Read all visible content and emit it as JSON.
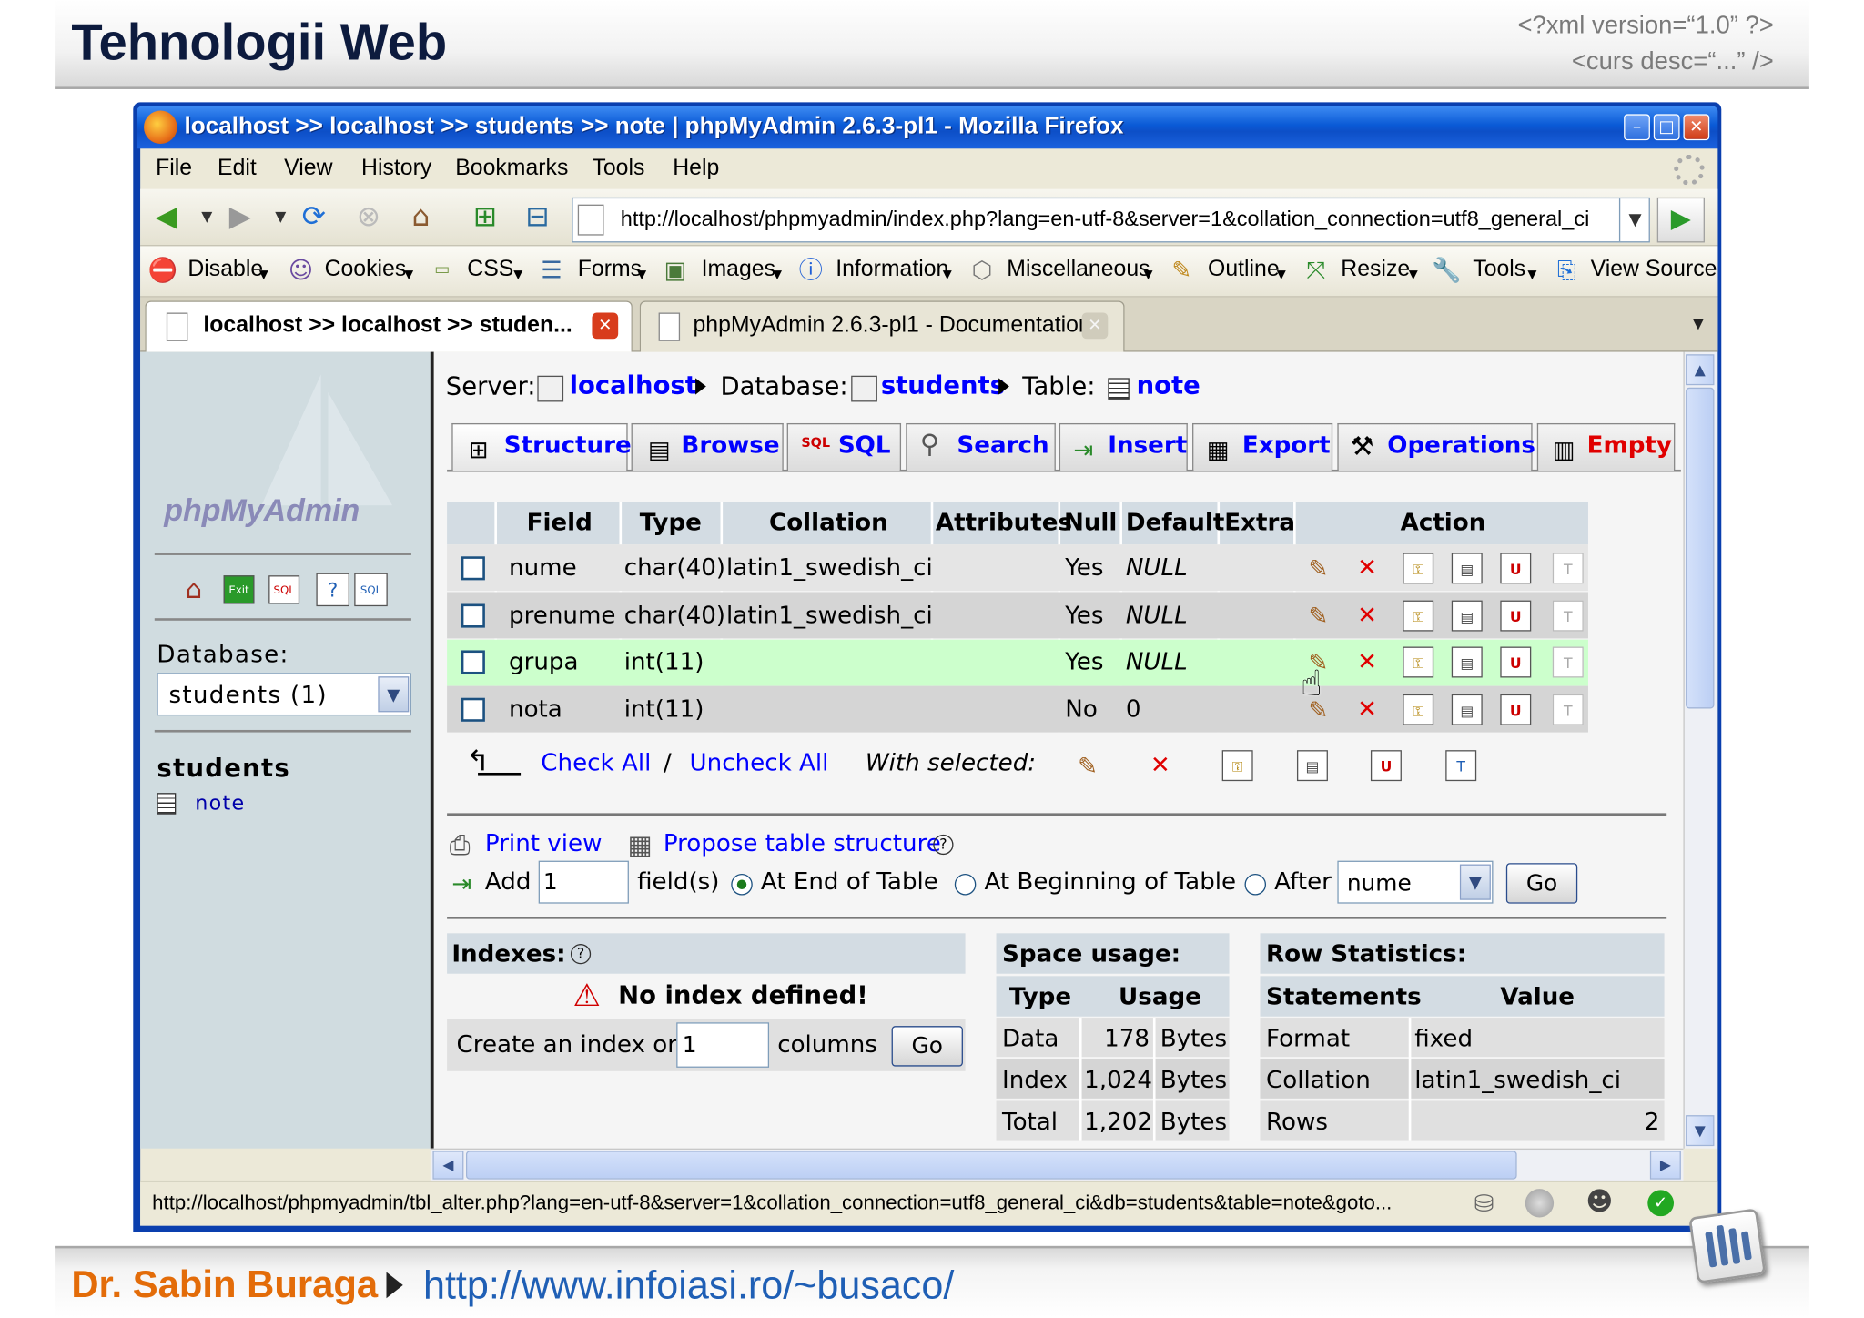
{
  "slide": {
    "title": "Tehnologii Web",
    "xml_line1": "<?xml version=“1.0” ?>",
    "xml_line2": "<curs desc=“...” />",
    "author": "Dr. Sabin Buraga",
    "url": "http://www.infoiasi.ro/~busaco/"
  },
  "browser": {
    "window_title": "localhost >> localhost >> students  >> note | phpMyAdmin 2.6.3-pl1 - Mozilla Firefox",
    "menu": [
      "File",
      "Edit",
      "View",
      "History",
      "Bookmarks",
      "Tools",
      "Help"
    ],
    "address": "http://localhost/phpmyadmin/index.php?lang=en-utf-8&server=1&collation_connection=utf8_general_ci",
    "webdev_toolbar": [
      "Disable",
      "Cookies",
      "CSS",
      "Forms",
      "Images",
      "Information",
      "Miscellaneous",
      "Outline",
      "Resize",
      "Tools",
      "View Source"
    ],
    "tabs": [
      {
        "label": "localhost >> localhost >> studen...",
        "active": true
      },
      {
        "label": "phpMyAdmin 2.6.3-pl1 - Documentation",
        "active": false
      }
    ],
    "status_url": "http://localhost/phpmyadmin/tbl_alter.php?lang=en-utf-8&server=1&collation_connection=utf8_general_ci&db=students&table=note&goto..."
  },
  "sidebar": {
    "logo": "phpMyAdmin",
    "database_label": "Database:",
    "database_select": "students (1)",
    "db_name": "students",
    "tables": [
      "note"
    ]
  },
  "breadcrumb": {
    "server_label": "Server:",
    "server": "localhost",
    "database_label": "Database:",
    "database": "students",
    "table_label": "Table:",
    "table": "note"
  },
  "main_tabs": [
    "Structure",
    "Browse",
    "SQL",
    "Search",
    "Insert",
    "Export",
    "Operations",
    "Empty"
  ],
  "structure": {
    "columns": [
      "Field",
      "Type",
      "Collation",
      "Attributes",
      "Null",
      "Default",
      "Extra",
      "Action"
    ],
    "rows": [
      {
        "field": "nume",
        "type": "char(40)",
        "collation": "latin1_swedish_ci",
        "attributes": "",
        "null": "Yes",
        "default": "NULL",
        "extra": ""
      },
      {
        "field": "prenume",
        "type": "char(40)",
        "collation": "latin1_swedish_ci",
        "attributes": "",
        "null": "Yes",
        "default": "NULL",
        "extra": ""
      },
      {
        "field": "grupa",
        "type": "int(11)",
        "collation": "",
        "attributes": "",
        "null": "Yes",
        "default": "NULL",
        "extra": ""
      },
      {
        "field": "nota",
        "type": "int(11)",
        "collation": "",
        "attributes": "",
        "null": "No",
        "default": "0",
        "extra": ""
      }
    ],
    "check_all": "Check All",
    "separator": "/",
    "uncheck_all": "Uncheck All",
    "with_selected": "With selected:"
  },
  "actions": {
    "print_view": "Print view",
    "propose": "Propose table structure",
    "add": "Add",
    "add_count": "1",
    "fields_label": "field(s)",
    "at_end": "At End of Table",
    "at_beginning": "At Beginning of Table",
    "after": "After",
    "after_field": "nume",
    "go": "Go"
  },
  "indexes": {
    "title": "Indexes:",
    "none": "No index defined!",
    "create_label": "Create an index on",
    "create_count": "1",
    "columns_label": "columns",
    "go": "Go"
  },
  "space_usage": {
    "title": "Space usage:",
    "headers": [
      "Type",
      "Usage"
    ],
    "rows": [
      {
        "type": "Data",
        "value": "178",
        "unit": "Bytes"
      },
      {
        "type": "Index",
        "value": "1,024",
        "unit": "Bytes"
      },
      {
        "type": "Total",
        "value": "1,202",
        "unit": "Bytes"
      }
    ]
  },
  "row_stats": {
    "title": "Row Statistics:",
    "headers": [
      "Statements",
      "Value"
    ],
    "rows": [
      {
        "name": "Format",
        "value": "fixed"
      },
      {
        "name": "Collation",
        "value": "latin1_swedish_ci"
      },
      {
        "name": "Rows",
        "value": "2"
      }
    ]
  },
  "colors": {
    "header_bg": "#d3dce3",
    "hover_row": "#ccffcc",
    "link": "#0000ff",
    "titlebar": "#0a5ad6",
    "author": "#e36c09"
  }
}
